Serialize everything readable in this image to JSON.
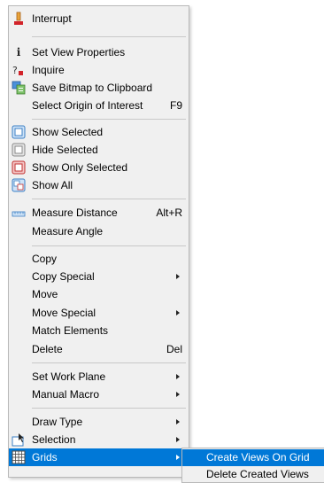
{
  "context_menu": {
    "items": [
      {
        "label": "Interrupt",
        "icon": "stop-sign-icon"
      },
      {
        "label": "Set View Properties",
        "icon": "info-icon"
      },
      {
        "label": "Inquire",
        "icon": "question-icon"
      },
      {
        "label": "Save Bitmap to Clipboard",
        "icon": "clipboard-bitmap-icon"
      },
      {
        "label": "Select Origin of Interest",
        "shortcut": "F9"
      },
      {
        "label": "Show Selected",
        "icon": "show-selected-icon"
      },
      {
        "label": "Hide Selected",
        "icon": "hide-selected-icon"
      },
      {
        "label": "Show Only Selected",
        "icon": "show-only-selected-icon"
      },
      {
        "label": "Show All",
        "icon": "show-all-icon"
      },
      {
        "label": "Measure Distance",
        "shortcut": "Alt+R",
        "icon": "ruler-icon"
      },
      {
        "label": "Measure Angle"
      },
      {
        "label": "Copy"
      },
      {
        "label": "Copy Special",
        "submenu": true
      },
      {
        "label": "Move"
      },
      {
        "label": "Move Special",
        "submenu": true
      },
      {
        "label": "Match Elements"
      },
      {
        "label": "Delete",
        "shortcut": "Del"
      },
      {
        "label": "Set Work Plane",
        "submenu": true
      },
      {
        "label": "Manual Macro",
        "submenu": true
      },
      {
        "label": "Draw Type",
        "submenu": true
      },
      {
        "label": "Selection",
        "submenu": true,
        "icon": "selection-cursor-icon"
      },
      {
        "label": "Grids",
        "submenu": true,
        "icon": "grid-icon",
        "selected": true
      }
    ]
  },
  "grids_submenu": {
    "items": [
      {
        "label": "Create Views On Grid",
        "selected": true
      },
      {
        "label": "Delete Created Views"
      }
    ]
  },
  "colors": {
    "menu_bg": "#f0f0f0",
    "highlight": "#0078d7",
    "separator": "#c8c8c8"
  }
}
